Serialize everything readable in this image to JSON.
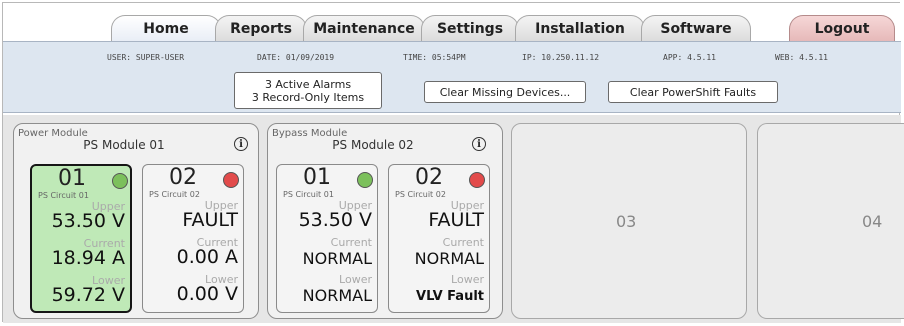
{
  "tabs": {
    "home": "Home",
    "reports": "Reports",
    "maintenance": "Maintenance",
    "settings": "Settings",
    "installation": "Installation",
    "software": "Software",
    "logout": "Logout"
  },
  "info": {
    "user": "USER: SUPER-USER",
    "date": "DATE: 01/09/2019",
    "time": "TIME: 05:54PM",
    "ip": "IP: 10.250.11.12",
    "app": "APP: 4.5.11",
    "web": "WEB: 4.5.11"
  },
  "alarms": {
    "line1": "3 Active Alarms",
    "line2": "3 Record-Only Items"
  },
  "buttons": {
    "clear_missing": "Clear Missing Devices...",
    "clear_powershift": "Clear PowerShift Faults"
  },
  "modules": [
    {
      "type": "Power Module",
      "name": "PS Module 01",
      "circuits": [
        {
          "num": "01",
          "name": "PS Circuit 01",
          "status_color": "#7cc05c",
          "upper_label": "Upper",
          "upper_value": "53.50 V",
          "current_label": "Current",
          "current_value": "18.94 A",
          "lower_label": "Lower",
          "lower_value": "59.72 V"
        },
        {
          "num": "02",
          "name": "PS Circuit 02",
          "status_color": "#e24b4b",
          "upper_label": "Upper",
          "upper_value": "FAULT",
          "current_label": "Current",
          "current_value": "0.00 A",
          "lower_label": "Lower",
          "lower_value": "0.00 V"
        }
      ]
    },
    {
      "type": "Bypass Module",
      "name": "PS Module 02",
      "circuits": [
        {
          "num": "01",
          "name": "PS Circuit 01",
          "status_color": "#7cc05c",
          "upper_label": "Upper",
          "upper_value": "53.50 V",
          "current_label": "Current",
          "current_value": "NORMAL",
          "lower_label": "Lower",
          "lower_value": "NORMAL"
        },
        {
          "num": "02",
          "name": "PS Circuit 02",
          "status_color": "#e24b4b",
          "upper_label": "Upper",
          "upper_value": "FAULT",
          "current_label": "Current",
          "current_value": "NORMAL",
          "lower_label": "Lower",
          "lower_value": "VLV Fault"
        }
      ]
    }
  ],
  "empty_slots": [
    "03",
    "04"
  ],
  "icons": {
    "info": "info-icon"
  },
  "info_icon_glyph": "i"
}
